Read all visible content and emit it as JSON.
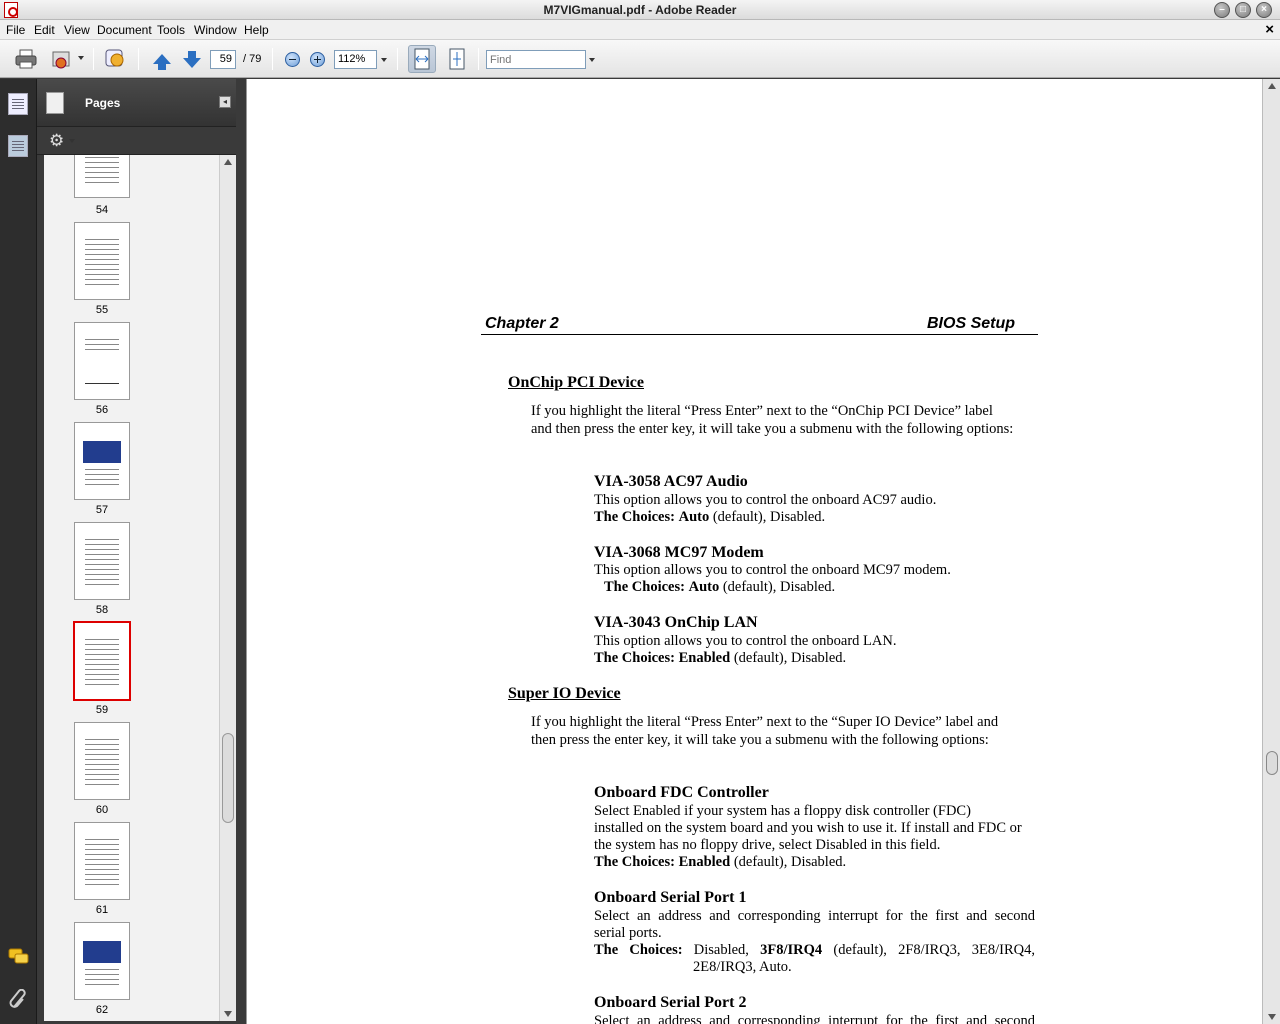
{
  "window": {
    "title": "M7VIGmanual.pdf - Adobe Reader"
  },
  "menu": [
    "File",
    "Edit",
    "View",
    "Document",
    "Tools",
    "Window",
    "Help"
  ],
  "menu_close": "×",
  "toolbar": {
    "page_current": "59",
    "page_total": "/ 79",
    "zoom": "112%",
    "find_placeholder": "Find"
  },
  "pages_panel": {
    "title": "Pages",
    "thumbnails": [
      {
        "num": "54"
      },
      {
        "num": "55"
      },
      {
        "num": "56"
      },
      {
        "num": "57"
      },
      {
        "num": "58"
      },
      {
        "num": "59"
      },
      {
        "num": "60"
      },
      {
        "num": "61"
      },
      {
        "num": "62"
      }
    ],
    "selected": "59"
  },
  "document": {
    "header_left": "Chapter 2",
    "header_right": "BIOS Setup",
    "sections": [
      {
        "title": "OnChip PCI Device",
        "intro_1": "If you highlight the literal “Press Enter” next to the “OnChip PCI Device” label",
        "intro_2": "and then press the enter key, it will take you a submenu with the following options:",
        "options": [
          {
            "title": "VIA-3058 AC97 Audio",
            "text": "This option allows you to control the onboard AC97 audio.",
            "choices_label": "The Choices:",
            "choices_default": "Auto",
            "choices_rest": " (default), Disabled."
          },
          {
            "title": "VIA-3068 MC97 Modem",
            "text": "This option allows you to control the onboard MC97 modem.",
            "choices_label": "The Choices:",
            "choices_default": "Auto",
            "choices_rest": " (default), Disabled."
          },
          {
            "title": "VIA-3043 OnChip LAN",
            "text": "This option allows you to control the onboard LAN.",
            "choices_label": "The Choices:",
            "choices_default": "Enabled",
            "choices_rest": " (default), Disabled."
          }
        ]
      },
      {
        "title": "Super IO Device",
        "intro_1": "If you highlight the literal “Press Enter” next to the “Super IO Device” label and",
        "intro_2": "then press the enter key, it will take you a submenu with the following options:",
        "options": [
          {
            "title": "Onboard FDC Controller",
            "text_1": "Select Enabled if your system has a floppy disk controller (FDC)",
            "text_2": "installed on the system board and you wish to use it. If install and FDC or",
            "text_3": "the system has no floppy drive, select Disabled in this field.",
            "choices_label": "The Choices:",
            "choices_default": "Enabled",
            "choices_rest": " (default), Disabled."
          },
          {
            "title": "Onboard Serial Port 1",
            "text_1": "Select an address and corresponding interrupt for the first and second",
            "text_2": "serial ports.",
            "choices_label": "The Choices:",
            "choices_pre": " Disabled, ",
            "choices_default": "3F8/IRQ4",
            "choices_rest": " (default), 2F8/IRQ3, 3E8/IRQ4,",
            "choices_line2": "2E8/IRQ3, Auto."
          },
          {
            "title": "Onboard Serial Port 2",
            "text_1": "Select an address and corresponding interrupt for the first and second"
          }
        ]
      }
    ]
  }
}
